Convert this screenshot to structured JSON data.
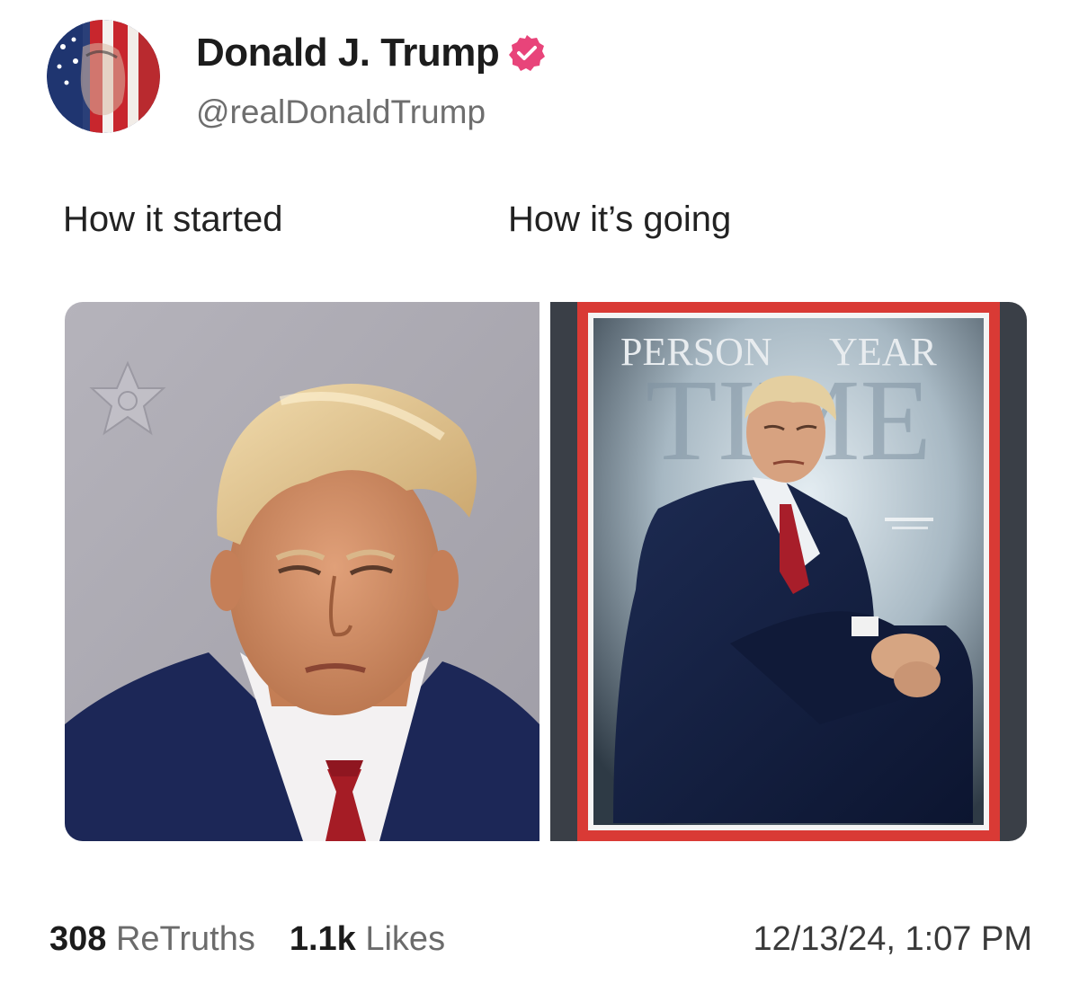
{
  "author": {
    "display_name": "Donald J. Trump",
    "handle": "@realDonaldTrump",
    "verified_icon": "verified-badge-icon",
    "badge_color": "#e8447a"
  },
  "post": {
    "caption_left": "How it started",
    "caption_right": "How it’s going"
  },
  "media": {
    "left_image": "mugshot-photo",
    "right_image": "time-magazine-cover",
    "cover_title_left": "PERSON",
    "cover_title_right": "YEAR",
    "cover_masthead": "TIME",
    "cover_border_color": "#d93a35"
  },
  "stats": {
    "retruths_count": "308",
    "retruths_label": "ReTruths",
    "likes_count": "1.1k",
    "likes_label": "Likes"
  },
  "timestamp": "12/13/24, 1:07 PM"
}
